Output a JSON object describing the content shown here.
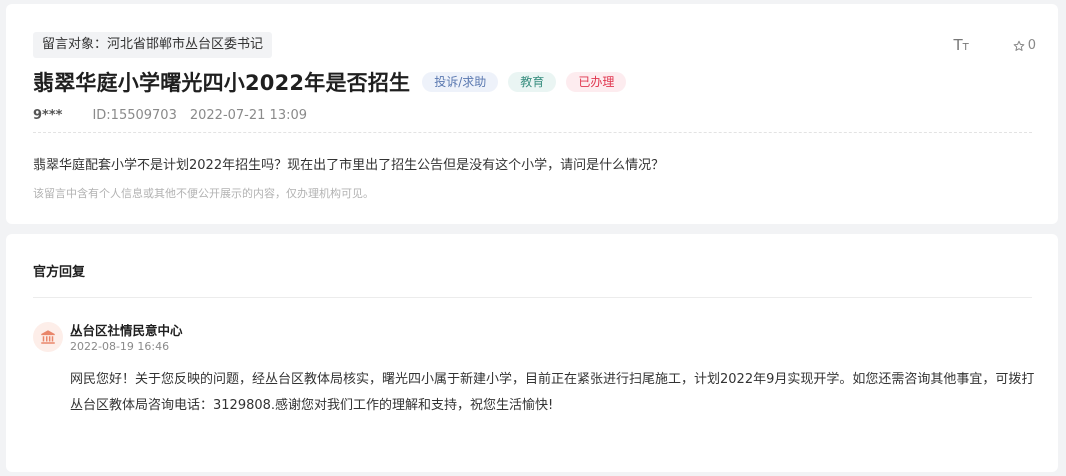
{
  "message": {
    "target_label": "留言对象：河北省邯郸市丛台区委书记",
    "title": "翡翠华庭小学曙光四小2022年是否招生",
    "tags": {
      "type": "投诉/求助",
      "category": "教育",
      "status": "已办理"
    },
    "font_size_icon": "Tт",
    "font_size_big": "T",
    "font_size_small": "T",
    "star_count": "0",
    "author": "9***",
    "id_text": "ID:15509703",
    "datetime": "2022-07-21 13:09",
    "content": "翡翠华庭配套小学不是计划2022年招生吗？现在出了市里出了招生公告但是没有这个小学，请问是什么情况？",
    "privacy_note": "该留言中含有个人信息或其他不便公开展示的内容，仅办理机构可见。"
  },
  "reply": {
    "section_title": "官方回复",
    "department": "丛台区社情民意中心",
    "time": "2022-08-19 16:46",
    "text": "网民您好！关于您反映的问题，经丛台区教体局核实，曙光四小属于新建小学，目前正在紧张进行扫尾施工，计划2022年9月实现开学。如您还需咨询其他事宜，可拨打丛台区教体局咨询电话：3129808.感谢您对我们工作的理解和支持，祝您生活愉快!"
  },
  "icons": {
    "font_size": "font-size-icon",
    "star": "star-outline-icon",
    "avatar": "government-building-icon"
  },
  "colors": {
    "page_bg": "#f2f3f5",
    "tag_type": "#5a78b0",
    "tag_category": "#3a8f80",
    "tag_status": "#e0364f",
    "avatar_icon": "#e9866a"
  }
}
